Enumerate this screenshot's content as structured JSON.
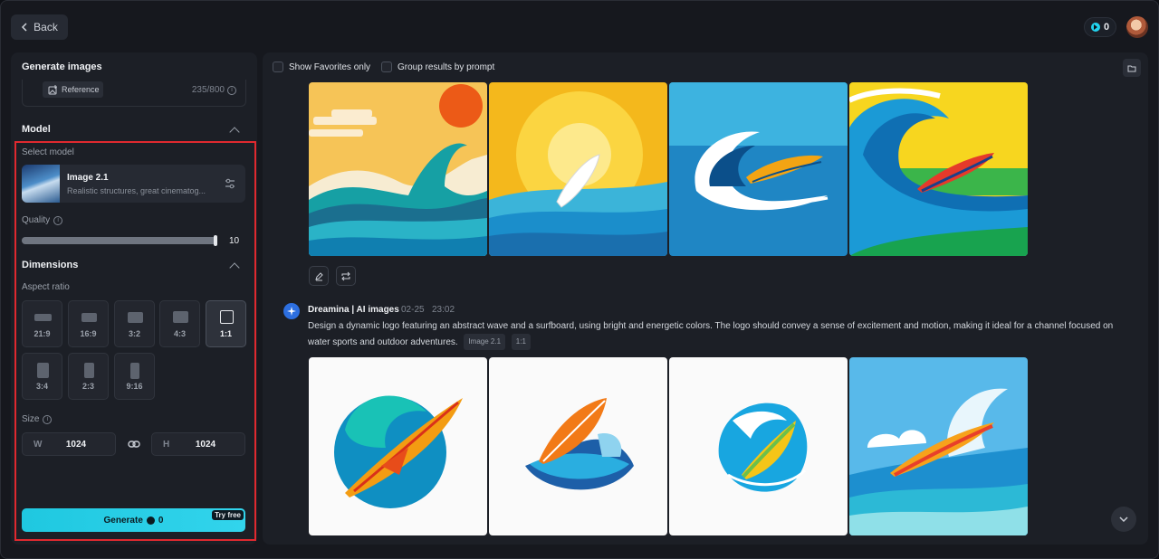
{
  "header": {
    "back_label": "Back",
    "credits": "0"
  },
  "sidebar": {
    "title": "Generate images",
    "prompt": {
      "reference_label": "Reference",
      "char_count": "235/800"
    },
    "model_section": {
      "title": "Model",
      "select_label": "Select model",
      "model_name": "Image 2.1",
      "model_desc": "Realistic structures, great cinematog..."
    },
    "quality": {
      "label": "Quality",
      "value": "10",
      "fraction": 1.0
    },
    "dimensions": {
      "title": "Dimensions",
      "aspect_label": "Aspect ratio",
      "ratios": [
        "21:9",
        "16:9",
        "3:2",
        "4:3",
        "1:1",
        "3:4",
        "2:3",
        "9:16"
      ],
      "selected_ratio": "1:1",
      "size_label": "Size",
      "width_prefix": "W",
      "width": "1024",
      "height_prefix": "H",
      "height": "1024"
    },
    "generate": {
      "label": "Generate",
      "cost": "0",
      "badge": "Try free"
    }
  },
  "results": {
    "show_favorites": "Show Favorites only",
    "group_by_prompt": "Group results by prompt",
    "entry": {
      "author": "Dreamina | AI images",
      "date": "02-25",
      "time": "23:02",
      "prompt": "Design a dynamic logo featuring an abstract wave and a surfboard, using bright and energetic colors. The logo should convey a sense of excitement and motion, making it ideal for a channel focused on water sports and outdoor adventures.",
      "model_tag": "Image 2.1",
      "ratio_tag": "1:1"
    }
  },
  "colors": {
    "accent": "#22d3ee",
    "highlight_border": "#e0292f",
    "panel": "#1c1f26"
  }
}
